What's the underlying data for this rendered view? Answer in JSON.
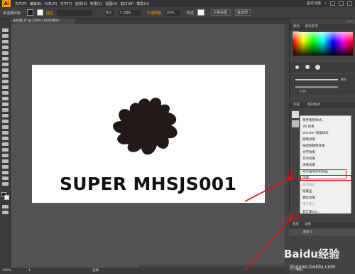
{
  "app": {
    "logo": "Ai",
    "menus": [
      "文件(F)",
      "编辑(E)",
      "对象(O)",
      "文字(T)",
      "选择(S)",
      "效果(C)",
      "视图(V)",
      "窗口(W)",
      "帮助(H)"
    ],
    "workspace": "基本功能",
    "search_icon": "search-icon"
  },
  "control_bar": {
    "selection": "未选择对象",
    "stroke_label": "描边",
    "stroke_value": "",
    "profile_value": "等比",
    "brush_value": "5 点圆形",
    "opacity_label": "不透明度",
    "opacity_value": "100%",
    "style_label": "样式",
    "doc_setup": "文档设置",
    "prefs": "首选项"
  },
  "document": {
    "tab": "未标题-1* @ 100% (RGB/预览)",
    "artboard_text": "SUPER MHSJS001"
  },
  "status": {
    "zoom": "100%",
    "page": "1",
    "tool": "选择"
  },
  "panels": {
    "color_tab": "颜色",
    "color_guide_tab": "颜色参考",
    "stroke_label": "基本",
    "stroke_value": "6.00",
    "appearance_tab": "外观",
    "graphic_styles_tab": "图形样式",
    "layers_tab": "图层",
    "artboards_tab": "画板",
    "layer_name": "图层 1",
    "layer_count": "1 个图层"
  },
  "menu": {
    "items": [
      {
        "label": "保存图形样式...",
        "state": "normal"
      },
      {
        "label": "3D 效果",
        "state": "normal"
      },
      {
        "label": "Vonster 图案样式",
        "state": "normal"
      },
      {
        "label": "图像效果",
        "state": "normal"
      },
      {
        "label": "按钮和翻转效果",
        "state": "normal"
      },
      {
        "label": "文字效果",
        "state": "normal"
      },
      {
        "label": "艺术效果",
        "state": "normal"
      },
      {
        "label": "涂抹效果",
        "state": "normal"
      },
      {
        "label": "斑点画笔的附属品",
        "state": "normal"
      },
      {
        "label": "纹理",
        "state": "highlighted"
      },
      {
        "label": "照亮样式",
        "state": "disabled"
      },
      {
        "label": "附属品",
        "state": "normal"
      },
      {
        "label": "霓虹效果",
        "state": "normal"
      },
      {
        "label": "用户定义",
        "state": "disabled"
      },
      {
        "label": "其它库(O)...",
        "state": "normal"
      }
    ]
  },
  "watermark": {
    "brand": "Baidu经验",
    "url": "jingyan.baidu.com"
  },
  "colors": {
    "accent": "#ff9a00",
    "highlight_red": "#e01010",
    "art": "#221a17"
  }
}
